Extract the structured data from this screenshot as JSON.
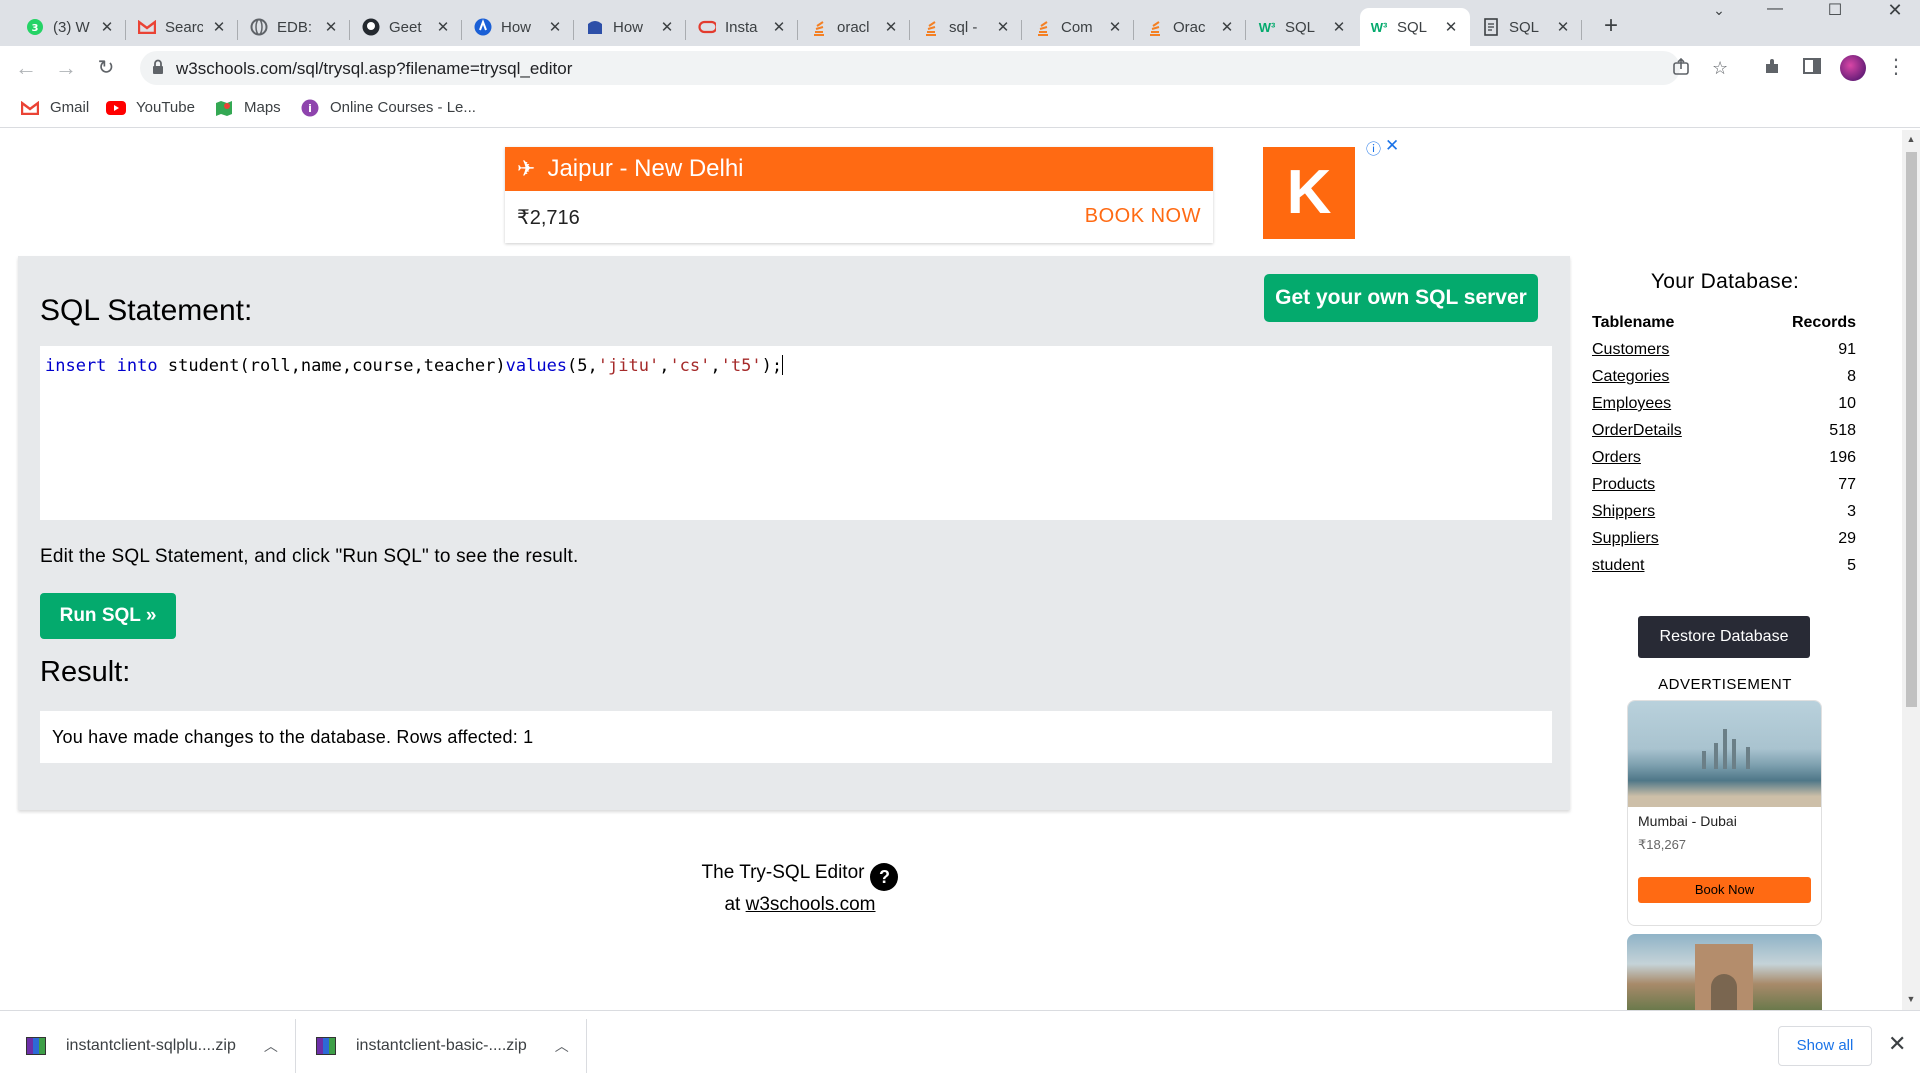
{
  "browser": {
    "tabs": [
      {
        "title": "(3) W",
        "icon": "whatsapp-icon",
        "color": "#25d366",
        "active": false
      },
      {
        "title": "Searc",
        "icon": "gmail-icon",
        "color": "#ea4335",
        "active": false
      },
      {
        "title": "EDB:",
        "icon": "globe-icon",
        "color": "#5f6368",
        "active": false
      },
      {
        "title": "Geet",
        "icon": "github-icon",
        "color": "#24292f",
        "active": false
      },
      {
        "title": "How",
        "icon": "blue-circle-icon",
        "color": "#1a5fd6",
        "active": false
      },
      {
        "title": "How",
        "icon": "blue-wave-icon",
        "color": "#2d4fa8",
        "active": false
      },
      {
        "title": "Insta",
        "icon": "oracle-icon",
        "color": "#e33b2e",
        "active": false
      },
      {
        "title": "oracl",
        "icon": "stackoverflow-icon",
        "color": "#f48024",
        "active": false
      },
      {
        "title": "sql -",
        "icon": "stackoverflow-icon",
        "color": "#f48024",
        "active": false
      },
      {
        "title": "Com",
        "icon": "stackoverflow-icon",
        "color": "#f48024",
        "active": false
      },
      {
        "title": "Orac",
        "icon": "stackoverflow-icon",
        "color": "#f48024",
        "active": false
      },
      {
        "title": "SQL",
        "icon": "w3schools-icon",
        "color": "#04aa6d",
        "active": false
      },
      {
        "title": "SQL",
        "icon": "w3schools-icon",
        "color": "#04aa6d",
        "active": true
      },
      {
        "title": "SQL",
        "icon": "doc-icon",
        "color": "#3c4043",
        "active": false
      }
    ],
    "new_tab": "+",
    "url": "w3schools.com/sql/trysql.asp?filename=trysql_editor",
    "bookmarks": [
      {
        "label": "Gmail",
        "icon": "gmail-icon",
        "color": "#ea4335"
      },
      {
        "label": "YouTube",
        "icon": "youtube-icon",
        "color": "#ff0000"
      },
      {
        "label": "Maps",
        "icon": "maps-icon",
        "color": "#34a853"
      },
      {
        "label": "Online Courses - Le...",
        "icon": "courses-icon",
        "color": "#8e44ad"
      }
    ]
  },
  "ad_top": {
    "route": "Jaipur - New Delhi",
    "price": "₹2,716",
    "cta": "BOOK NOW",
    "brand_letter": "K",
    "info_glyph": "ⓘ",
    "close_glyph": "✕"
  },
  "editor": {
    "heading": "SQL Statement:",
    "get_server": "Get your own SQL server",
    "code": {
      "t1": "insert",
      "t2": " ",
      "t3": "into",
      "t4": " student(roll,name,course,teacher)",
      "t5": "values",
      "t6": "(5,",
      "t7": "'jitu'",
      "t8": ",",
      "t9": "'cs'",
      "t10": ",",
      "t11": "'t5'",
      "t12": ");"
    },
    "hint": "Edit the SQL Statement, and click \"Run SQL\" to see the result.",
    "run_label": "Run SQL »",
    "result_heading": "Result:",
    "result_text": "You have made changes to the database. Rows affected: 1"
  },
  "footer": {
    "line1": "The Try-SQL Editor",
    "qmark": "?",
    "at": "at ",
    "link": "w3schools.com"
  },
  "sidebar": {
    "title": "Your Database:",
    "col_name": "Tablename",
    "col_records": "Records",
    "tables": [
      {
        "name": "Customers",
        "records": "91"
      },
      {
        "name": "Categories",
        "records": "8"
      },
      {
        "name": "Employees",
        "records": "10"
      },
      {
        "name": "OrderDetails",
        "records": "518"
      },
      {
        "name": "Orders",
        "records": "196"
      },
      {
        "name": "Products",
        "records": "77"
      },
      {
        "name": "Shippers",
        "records": "3"
      },
      {
        "name": "Suppliers",
        "records": "29"
      },
      {
        "name": "student",
        "records": "5"
      }
    ],
    "restore": "Restore Database",
    "ad_label": "ADVERTISEMENT",
    "ad_card": {
      "route": "Mumbai - Dubai",
      "price": "₹18,267",
      "cta": "Book Now"
    }
  },
  "downloads": {
    "items": [
      {
        "name": "instantclient-sqlplu....zip"
      },
      {
        "name": "instantclient-basic-....zip"
      }
    ],
    "show_all": "Show all"
  },
  "colors": {
    "w3_green": "#04aa6d",
    "ad_orange": "#ff6a13",
    "panel_bg": "#e7e9eb",
    "restore_bg": "#282a35"
  }
}
